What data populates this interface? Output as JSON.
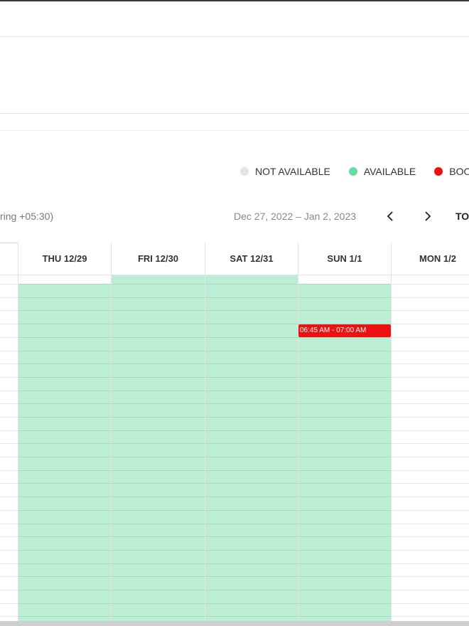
{
  "legend": [
    {
      "label": "NOT AVAILABLE",
      "color": "#e4e4e4"
    },
    {
      "label": "AVAILABLE",
      "color": "#5fe0a0"
    },
    {
      "label": "BOOKED",
      "color": "#ee1111"
    }
  ],
  "toolbar": {
    "timezone_partial": "ring +05:30)",
    "date_range": "Dec 27, 2022 – Jan 2, 2023",
    "prev_icon": "chevron-left-icon",
    "next_icon": "chevron-right-icon",
    "today_label": "TODAY"
  },
  "calendar": {
    "days": [
      "THU 12/29",
      "FRI 12/30",
      "SAT 12/31",
      "SUN 1/1",
      "MON 1/2"
    ],
    "available_days": [
      "THU 12/29",
      "FRI 12/30",
      "SAT 12/31",
      "SUN 1/1"
    ],
    "event": {
      "label": "06:45 AM - 07:00 AM",
      "day": "SUN 1/1",
      "color": "#ee1111"
    }
  }
}
